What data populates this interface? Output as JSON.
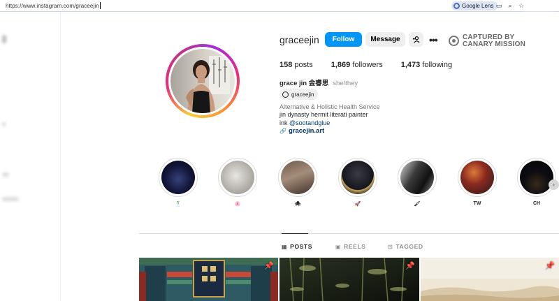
{
  "browser": {
    "url": "https://www.instagram.com/graceejin",
    "lens_label": "Google Lens"
  },
  "profile": {
    "username": "graceejin",
    "follow_label": "Follow",
    "message_label": "Message",
    "posts_count": "158",
    "posts_label": "posts",
    "followers_count": "1,869",
    "followers_label": "followers",
    "following_count": "1,473",
    "following_label": "following",
    "full_name": "grace jin 金睿思",
    "pronouns": "she/they",
    "threads_handle": "graceejin",
    "category": "Alternative & Holistic Health Service",
    "bio_line1": "jin dynasty hermit literati painter",
    "bio_line2_prefix": "ink",
    "bio_mention": "@sootandglue",
    "website": "gracejin.art"
  },
  "watermark": {
    "line1": "CAPTURED BY",
    "line2": "CANARY MISSION"
  },
  "highlights": [
    {
      "label": "🕺",
      "icon": "dancer-emoji"
    },
    {
      "label": "🌸",
      "icon": "flower-emoji"
    },
    {
      "label": "🕷",
      "icon": "spider-emoji"
    },
    {
      "label": "🚀",
      "icon": "rocket-emoji"
    },
    {
      "label": "🖌",
      "icon": "paintbrush-emoji"
    },
    {
      "label": "TW",
      "icon": ""
    },
    {
      "label": "CH",
      "icon": ""
    }
  ],
  "tabs": {
    "posts": "POSTS",
    "reels": "REELS",
    "tagged": "TAGGED"
  }
}
